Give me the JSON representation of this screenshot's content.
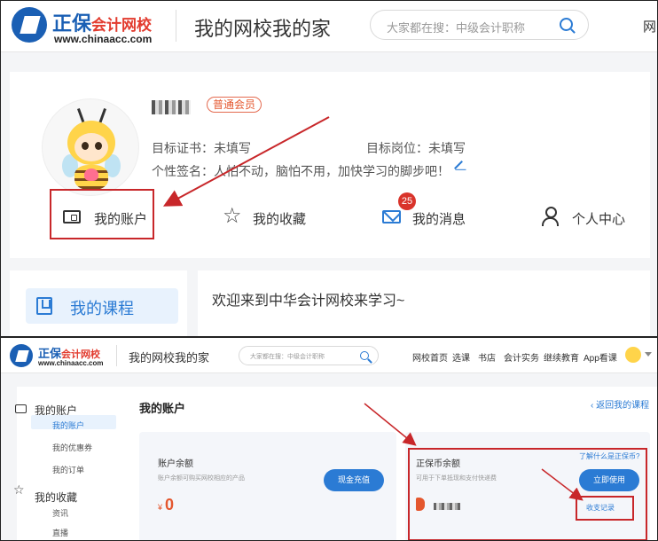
{
  "brand": {
    "name_blue": "正保",
    "name_red": "会计网校",
    "url": "www.chinaacc.com"
  },
  "header": {
    "title": "我的网校我的家",
    "search_placeholder": "大家都在搜：中级会计职称",
    "nav_cut": "网"
  },
  "profile": {
    "member_badge": "普通会员",
    "target_cert_label": "目标证书：",
    "target_cert_value": "未填写",
    "target_job_label": "目标岗位：",
    "target_job_value": "未填写",
    "signature_label": "个性签名：",
    "signature_value": "人怕不动，脑怕不用，加快学习的脚步吧！"
  },
  "profile_nav": [
    {
      "label": "我的账户",
      "icon": "wallet-icon"
    },
    {
      "label": "我的收藏",
      "icon": "star-icon"
    },
    {
      "label": "我的消息",
      "icon": "mail-icon",
      "badge": "25"
    },
    {
      "label": "个人中心",
      "icon": "user-icon"
    }
  ],
  "course": {
    "label": "我的课程",
    "icon": "book-icon"
  },
  "welcome": "欢迎来到中华会计网校来学习~",
  "bottom_header": {
    "title": "我的网校我的家",
    "search_placeholder": "大家都在搜：中级会计职称",
    "nav": [
      "网校首页",
      "选课",
      "书店",
      "会计实务",
      "继续教育",
      "App看课"
    ]
  },
  "sidebar": {
    "group1": {
      "label": "我的账户",
      "items": [
        "我的账户",
        "我的优惠券",
        "我的订单"
      ]
    },
    "group2": {
      "label": "我的收藏",
      "items": [
        "资讯",
        "直播"
      ]
    }
  },
  "account": {
    "title": "我的账户",
    "back_link": "返回我的课程",
    "balance": {
      "title": "账户余额",
      "desc": "账户余额可购买网校相应的产品",
      "currency": "¥",
      "amount": "0",
      "button": "现金充值"
    },
    "coins": {
      "title": "正保币余额",
      "desc": "可用于下单抵现和支付快递费",
      "help_link": "了解什么是正保币?",
      "button": "立即使用",
      "record_link": "收支记录"
    }
  },
  "colors": {
    "accent": "#2b7bd4",
    "annotation_red": "#c8272a",
    "badge_red": "#d9342b"
  }
}
